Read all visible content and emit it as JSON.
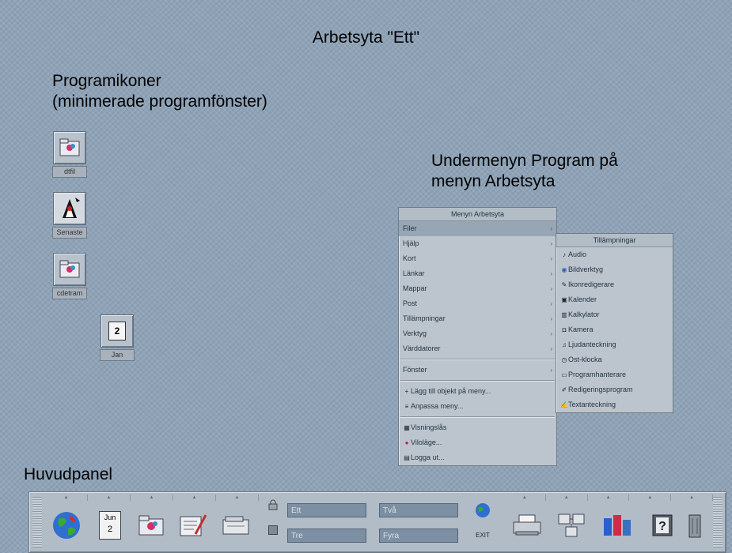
{
  "captions": {
    "workspace": "Arbetsyta \"Ett\"",
    "icons_line1": "Programikoner",
    "icons_line2": "(minimerade programfönster)",
    "submenu_line1": "Undermenyn Program på",
    "submenu_line2": "menyn Arbetsyta",
    "panel": "Huvudpanel"
  },
  "desktop_icons": [
    {
      "label": "dtfil",
      "icon": "file-manager-icon"
    },
    {
      "label": "Senaste",
      "icon": "duke-mascot-icon"
    },
    {
      "label": "cdetram",
      "icon": "file-manager-icon"
    },
    {
      "label": "Jan",
      "icon": "calendar-icon",
      "day": "2"
    }
  ],
  "workspace_menu": {
    "title": "Menyn Arbetsyta",
    "items": [
      {
        "label": "Filer",
        "submenu": true
      },
      {
        "label": "Hjälp",
        "submenu": true
      },
      {
        "label": "Kort",
        "submenu": true
      },
      {
        "label": "Länkar",
        "submenu": true
      },
      {
        "label": "Mappar",
        "submenu": true
      },
      {
        "label": "Post",
        "submenu": true
      },
      {
        "label": "Tillämpningar",
        "submenu": true
      },
      {
        "label": "Verktyg",
        "submenu": true
      },
      {
        "label": "Värddatorer",
        "submenu": true
      }
    ],
    "windows_item": "Fönster",
    "custom_items": [
      "Lägg till objekt på meny...",
      "Anpassa meny..."
    ],
    "end_items": [
      "Visningslås",
      "Viloläge...",
      "Logga ut..."
    ]
  },
  "apps_menu": {
    "title": "Tillämpningar",
    "items": [
      "Audio",
      "Bildverktyg",
      "Ikonredigerare",
      "Kalender",
      "Kalkylator",
      "Kamera",
      "Ljudanteckning",
      "Ost-klocka",
      "Programhanterare",
      "Redigeringsprogram",
      "Textanteckning"
    ]
  },
  "front_panel": {
    "calendar": {
      "month": "Jun",
      "day": "2"
    },
    "workspaces": [
      "Ett",
      "Två",
      "Tre",
      "Fyra"
    ],
    "exit_label": "EXIT"
  }
}
